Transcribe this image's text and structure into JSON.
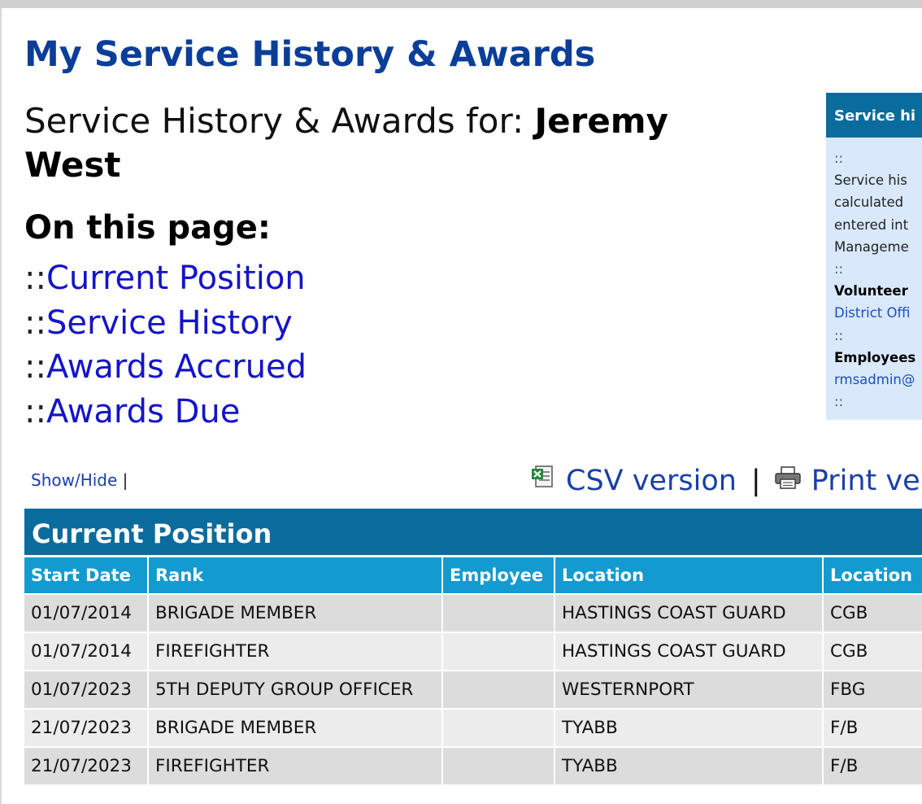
{
  "page_title": "My Service History & Awards",
  "subtitle": {
    "prefix": "Service History & Awards for: ",
    "name": "Jeremy West"
  },
  "on_this_page": {
    "heading": "On this page:",
    "separator": "::",
    "links": [
      "Current Position",
      "Service History",
      "Awards Accrued",
      "Awards Due"
    ]
  },
  "sidebox": {
    "title": "Service hi",
    "separator": "::",
    "text_lines": [
      "Service his",
      "calculated",
      "entered int",
      "Manageme"
    ],
    "volunteer_label": "Volunteer",
    "volunteer_link": "District Offi",
    "employee_label": "Employees",
    "employee_link": "rmsadmin@"
  },
  "toolbar": {
    "show_hide": "Show/Hide",
    "pipe": "|",
    "csv_label": "CSV version",
    "print_label": "Print ve"
  },
  "icons": {
    "csv": "spreadsheet-icon",
    "print": "printer-icon"
  },
  "current_position": {
    "title": "Current Position",
    "columns": [
      "Start Date",
      "Rank",
      "Employee",
      "Location",
      "Location"
    ],
    "rows": [
      [
        "01/07/2014",
        "BRIGADE MEMBER",
        "",
        "HASTINGS COAST GUARD",
        "CGB"
      ],
      [
        "01/07/2014",
        "FIREFIGHTER",
        "",
        "HASTINGS COAST GUARD",
        "CGB"
      ],
      [
        "01/07/2023",
        "5TH DEPUTY GROUP OFFICER",
        "",
        "WESTERNPORT",
        "FBG"
      ],
      [
        "21/07/2023",
        "BRIGADE MEMBER",
        "",
        "TYABB",
        "F/B"
      ],
      [
        "21/07/2023",
        "FIREFIGHTER",
        "",
        "TYABB",
        "F/B"
      ]
    ]
  },
  "colors": {
    "title_blue": "#0b3e99",
    "link_blue": "#1414c8",
    "header_dark": "#0a6b9d",
    "header_light": "#139bd0",
    "sidebox_bg": "#d9e9fb",
    "row_odd": "#dcdcdc",
    "row_even": "#ececec"
  }
}
